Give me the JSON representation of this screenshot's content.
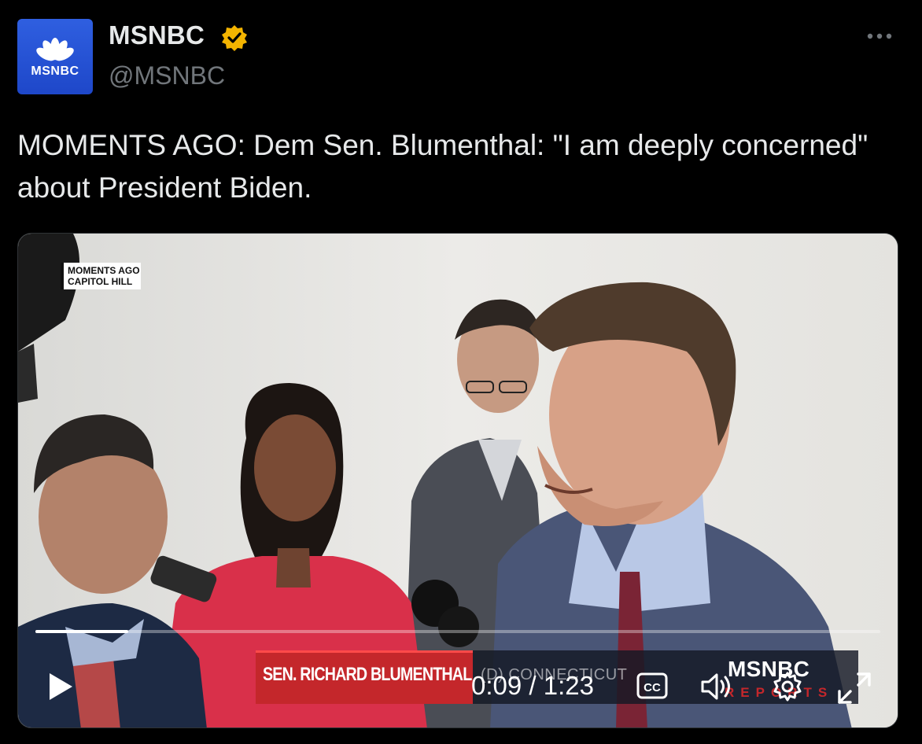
{
  "account": {
    "display_name": "MSNBC",
    "handle": "@MSNBC",
    "avatar_text": "MSNBC",
    "verified": true,
    "verified_color": "#f4b400"
  },
  "tweet": {
    "text": "MOMENTS AGO: Dem Sen. Blumenthal: \"I am deeply concerned\" about President Biden."
  },
  "video": {
    "bug_line1": "MOMENTS AGO",
    "bug_line2": "CAPITOL HILL",
    "lower_third_name": "SEN. RICHARD BLUMENTHAL",
    "lower_third_party": "(D) CONNECTICUT",
    "network_logo": "MSNBC",
    "network_show": "REPORTS",
    "current_time": "0:09",
    "duration": "1:23",
    "time_display": "0:09 / 1:23",
    "progress_fraction": 0.11,
    "controls": [
      "play-icon",
      "captions-icon",
      "volume-icon",
      "settings-icon",
      "fullscreen-icon"
    ]
  },
  "colors": {
    "background": "#000000",
    "text": "#e7e9ea",
    "muted": "#71767b",
    "brand_blue": "#2f5fe0",
    "chyron_red": "#c4272b"
  }
}
